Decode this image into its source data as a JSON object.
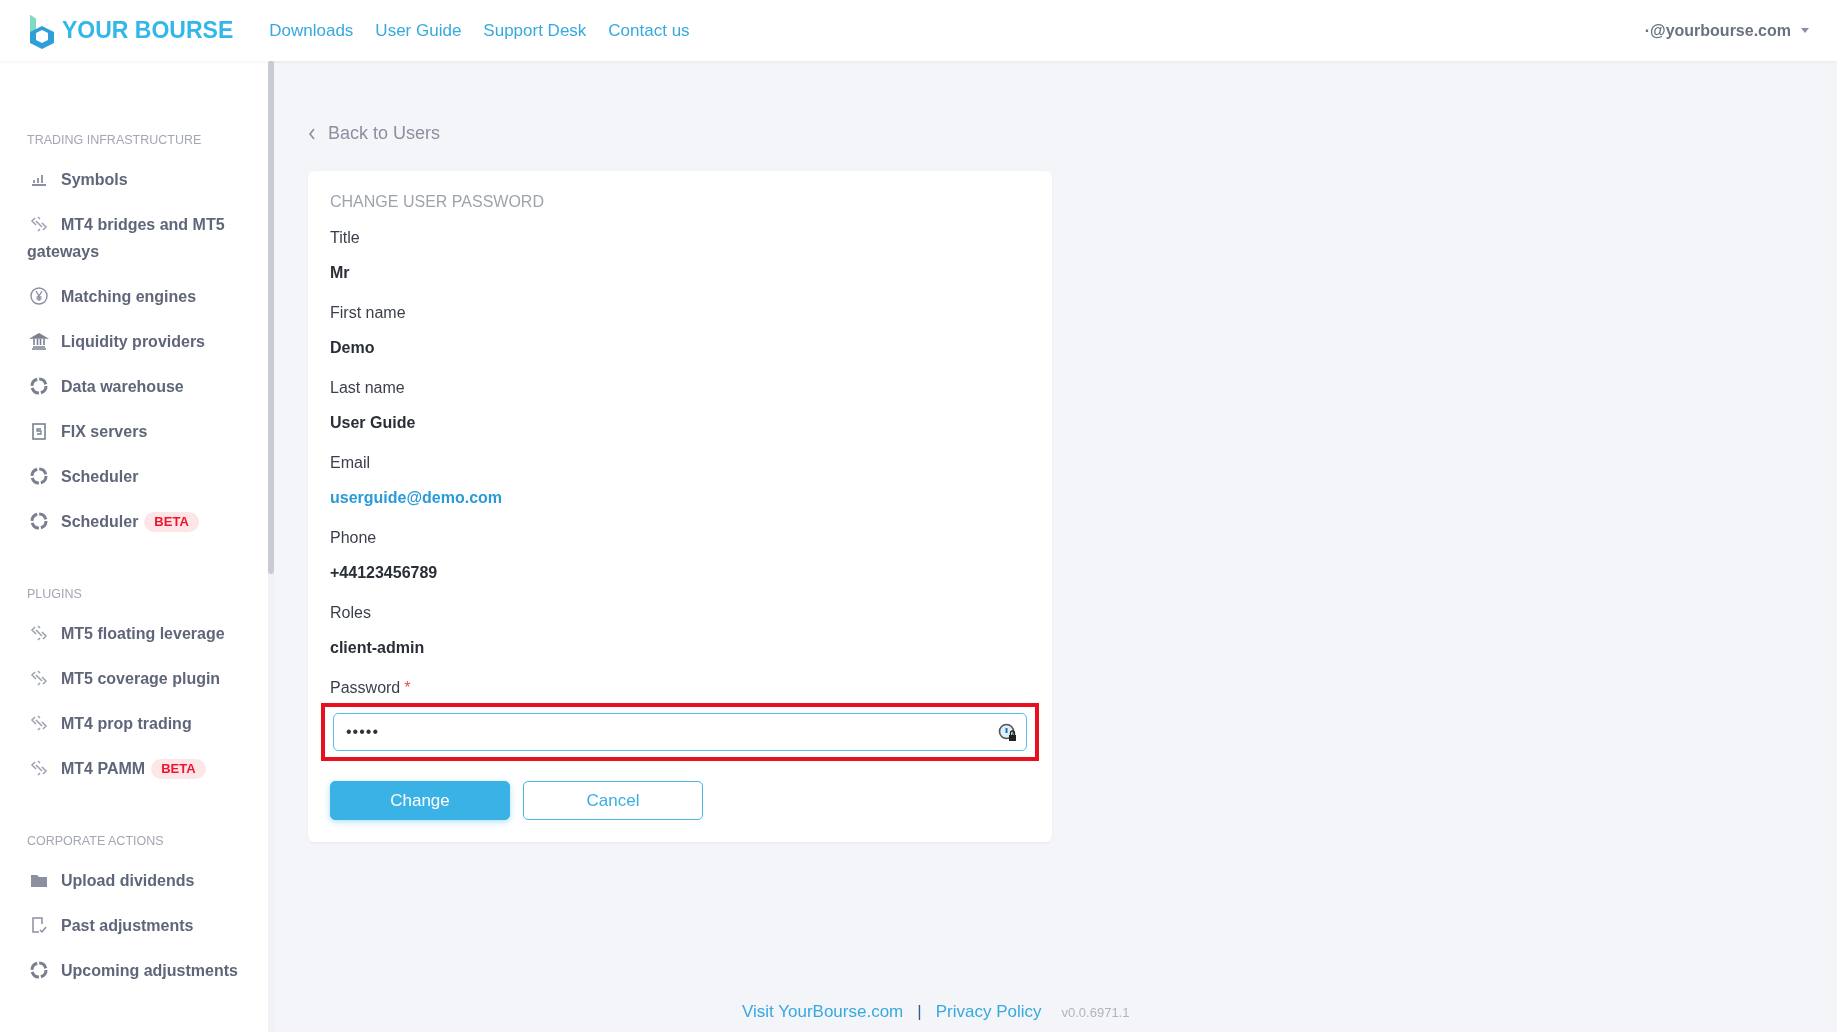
{
  "header": {
    "logo": "YOUR BOURSE",
    "nav": [
      "Downloads",
      "User Guide",
      "Support Desk",
      "Contact us"
    ],
    "account": "·@yourbourse.com"
  },
  "sidebar": {
    "sections": [
      {
        "heading": "TRADING INFRASTRUCTURE",
        "items": [
          {
            "label": "Symbols",
            "kind": "chart"
          },
          {
            "label": "MT4 bridges and MT5 gateways",
            "kind": "link"
          },
          {
            "label": "Matching engines",
            "kind": "yen"
          },
          {
            "label": "Liquidity providers",
            "kind": "bank"
          },
          {
            "label": "Data warehouse",
            "kind": "ring"
          },
          {
            "label": "FIX servers",
            "kind": "server"
          },
          {
            "label": "Scheduler",
            "kind": "ring"
          },
          {
            "label": "Scheduler",
            "kind": "ring",
            "badge": "BETA"
          }
        ]
      },
      {
        "heading": "PLUGINS",
        "items": [
          {
            "label": "MT5 floating leverage",
            "kind": "link"
          },
          {
            "label": "MT5 coverage plugin",
            "kind": "link"
          },
          {
            "label": "MT4 prop trading",
            "kind": "link"
          },
          {
            "label": "MT4 PAMM",
            "kind": "link",
            "badge": "BETA"
          }
        ]
      },
      {
        "heading": "CORPORATE ACTIONS",
        "items": [
          {
            "label": "Upload dividends",
            "kind": "folder"
          },
          {
            "label": "Past adjustments",
            "kind": "doc"
          },
          {
            "label": "Upcoming adjustments",
            "kind": "ring"
          }
        ]
      }
    ]
  },
  "back_link": "Back to Users",
  "card": {
    "title": "CHANGE USER PASSWORD",
    "fields": [
      {
        "label": "Title",
        "value": "Mr",
        "kind": "text"
      },
      {
        "label": "First name",
        "value": "Demo",
        "kind": "text"
      },
      {
        "label": "Last name",
        "value": "User Guide",
        "kind": "text"
      },
      {
        "label": "Email",
        "value": "userguide@demo.com",
        "kind": "link"
      },
      {
        "label": "Phone",
        "value": "+44123456789",
        "kind": "text"
      },
      {
        "label": "Roles",
        "value": "client-admin",
        "kind": "text"
      }
    ],
    "password": {
      "label": "Password",
      "required_mark": "*",
      "value": "•••••",
      "highlighted": true
    },
    "buttons": [
      {
        "label": "Change",
        "kind": "primary"
      },
      {
        "label": "Cancel",
        "kind": "secondary"
      }
    ]
  },
  "footer": {
    "links": [
      "Visit YourBourse.com",
      "Privacy Policy"
    ],
    "separator": "|",
    "version": "v0.0.6971.1"
  }
}
